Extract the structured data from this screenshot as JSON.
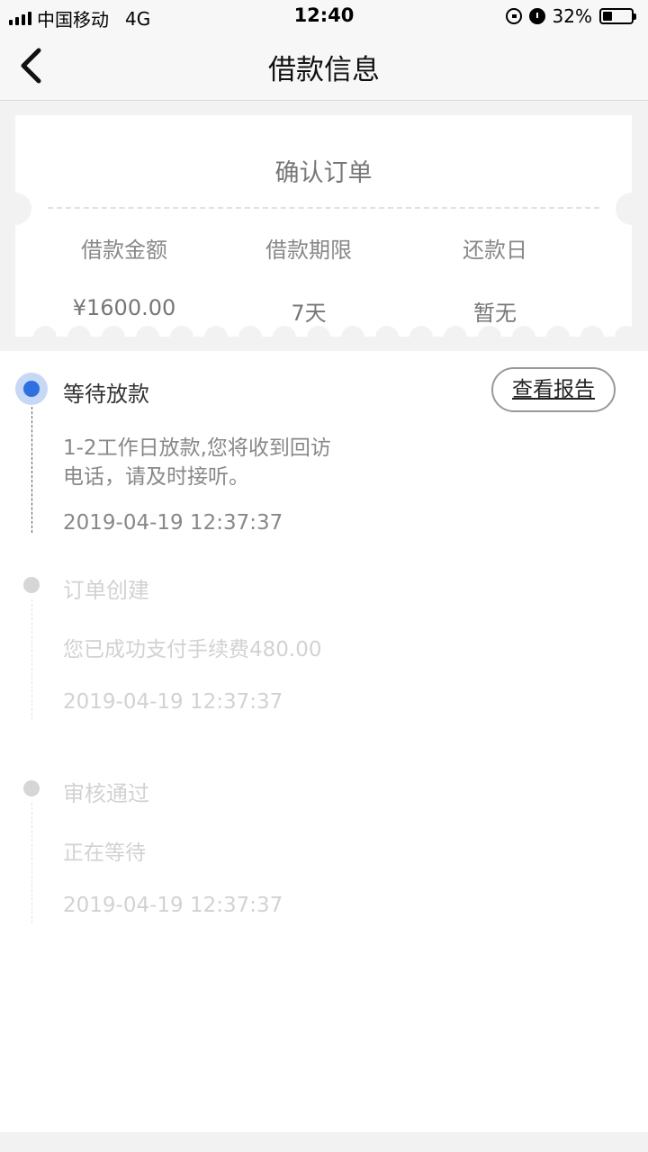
{
  "status_bar": {
    "carrier": "中国移动",
    "network": "4G",
    "time": "12:40",
    "battery_percent": "32%",
    "battery_level": 0.32
  },
  "nav": {
    "title": "借款信息"
  },
  "ticket": {
    "title": "确认订单",
    "columns": [
      {
        "label": "借款金额",
        "value": "¥1600.00"
      },
      {
        "label": "借款期限",
        "value": "7天"
      },
      {
        "label": "还款日",
        "value": "暂无"
      }
    ]
  },
  "report_button": "查看报告",
  "steps": [
    {
      "title": "等待放款",
      "desc_line1": "1-2工作日放款,您将收到回访",
      "desc_line2": "电话，请及时接听。",
      "time": "2019-04-19 12:37:37",
      "active": true
    },
    {
      "title": "订单创建",
      "desc": "您已成功支付手续费480.00",
      "time": "2019-04-19 12:37:37",
      "active": false
    },
    {
      "title": "审核通过",
      "desc": "正在等待",
      "time": "2019-04-19 12:37:37",
      "active": false
    }
  ],
  "colors": {
    "accent": "#2f6fe0",
    "accent_halo": "#c7d8f7",
    "inactive": "#d2d2d2"
  }
}
